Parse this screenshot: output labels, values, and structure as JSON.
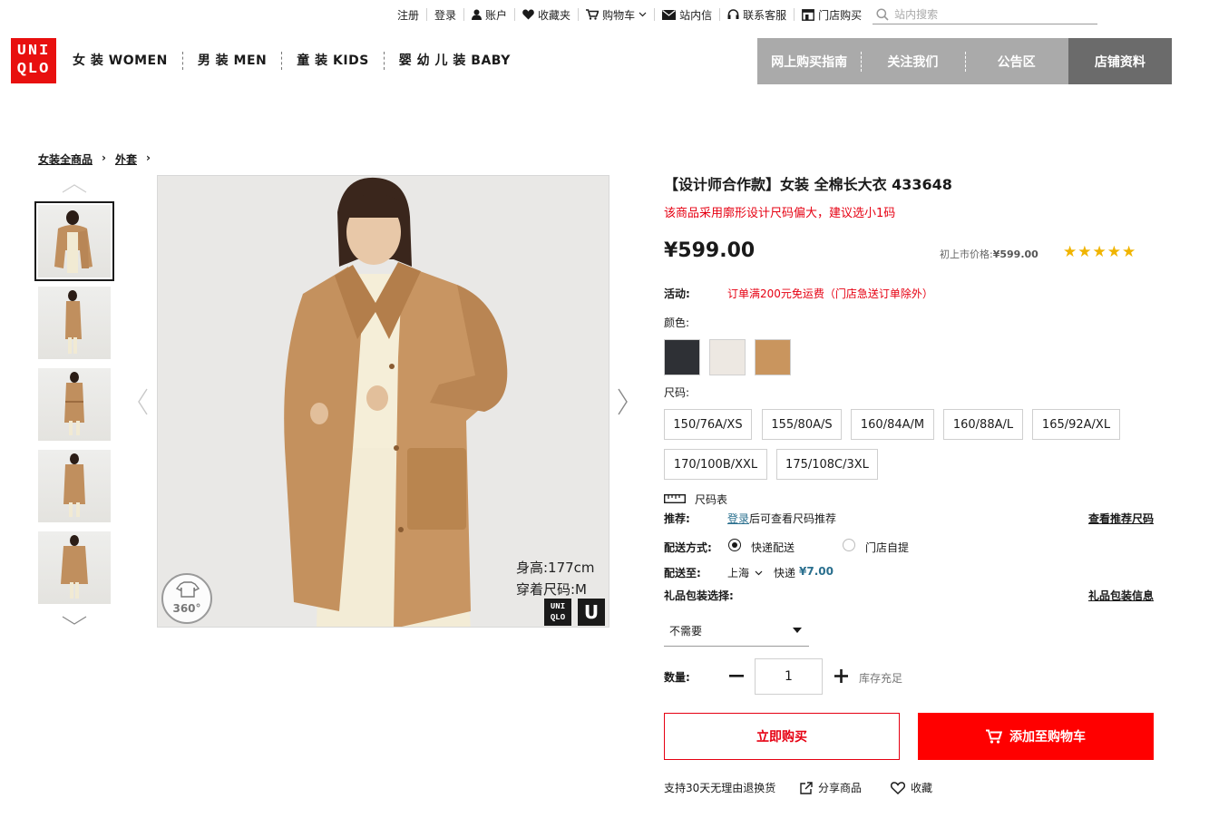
{
  "utility": {
    "register": "注册",
    "login": "登录",
    "account": "账户",
    "favorites": "收藏夹",
    "cart": "购物车",
    "messages": "站内信",
    "service": "联系客服",
    "store": "门店购买",
    "search_placeholder": "站内搜索"
  },
  "logo": {
    "line1": "UNI",
    "line2": "QLO"
  },
  "categories": [
    "女 装 WOMEN",
    "男 装 MEN",
    "童 装 KIDS",
    "婴 幼 儿 装 BABY"
  ],
  "right_nav": [
    "网上购买指南",
    "关注我们",
    "公告区",
    "店铺资料"
  ],
  "breadcrumb": [
    "女装全商品",
    "外套"
  ],
  "image": {
    "height_text": "身高:177cm",
    "size_text": "穿着尺码:M",
    "badge_360": "360°",
    "logo_u": "U"
  },
  "product": {
    "name": "【设计师合作款】女装 全棉长大衣 433648",
    "size_note": "该商品采用廓形设计尺码偏大，建议选小1码",
    "price": "¥599.00",
    "orig_label": "初上市价格:",
    "orig_price": "¥599.00",
    "rating": 5,
    "stars": "★★★★★",
    "promo_label": "活动:",
    "promo_text": "订单满200元免运费（门店急送订单除外）",
    "color_label": "颜色:",
    "colors": [
      "#2e3035",
      "#ede8e2",
      "#c9955e"
    ],
    "size_label": "尺码:",
    "sizes": [
      "150/76A/XS",
      "155/80A/S",
      "160/84A/M",
      "160/88A/L",
      "165/92A/XL",
      "170/100B/XXL",
      "175/108C/3XL"
    ],
    "size_chart": "尺码表",
    "recommend_label": "推荐:",
    "recommend_login": "登录",
    "recommend_text": "后可查看尺码推荐",
    "recommend_link": "查看推荐尺码",
    "delivery_label": "配送方式:",
    "delivery_express": "快递配送",
    "delivery_pickup": "门店自提",
    "ship_to_label": "配送至:",
    "ship_city": "上海",
    "ship_method": "快递",
    "ship_fee": "¥7.00",
    "gift_label": "礼品包装选择:",
    "gift_link": "礼品包装信息",
    "gift_value": "不需要",
    "qty_label": "数量:",
    "qty": "1",
    "stock": "库存充足",
    "buy_now": "立即购买",
    "add_cart": "添加至购物车",
    "returns": "支持30天无理由退换货",
    "share": "分享商品",
    "favorite": "收藏"
  },
  "colors": {
    "brand_red": "#e60012",
    "nav_gray": "#aaaaaa",
    "nav_dark": "#6b6b6b",
    "star": "#f0b400"
  }
}
